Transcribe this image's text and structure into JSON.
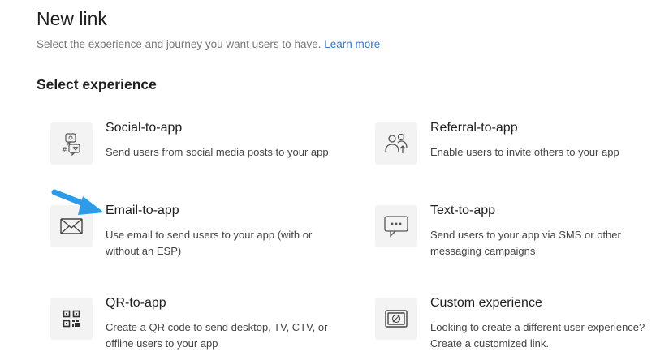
{
  "header": {
    "title": "New link",
    "subtitle": "Select the experience and journey you want users to have.",
    "learn_more": "Learn more"
  },
  "section": {
    "title": "Select experience"
  },
  "cards": {
    "social": {
      "title": "Social-to-app",
      "description": "Send users from social media posts to your app",
      "icon": "social-chat-icon"
    },
    "referral": {
      "title": "Referral-to-app",
      "description": "Enable users to invite others to your app",
      "icon": "referral-users-icon"
    },
    "email": {
      "title": "Email-to-app",
      "description": "Use email to send users to your app (with or without an ESP)",
      "icon": "envelope-icon"
    },
    "text": {
      "title": "Text-to-app",
      "description": "Send users to your app via SMS or other messaging campaigns",
      "icon": "sms-bubble-icon"
    },
    "qr": {
      "title": "QR-to-app",
      "description": "Create a QR code to send desktop, TV, CTV, or offline users to your app",
      "icon": "qr-code-icon"
    },
    "custom": {
      "title": "Custom experience",
      "description": "Looking to create a different user experience? Create a customized link.",
      "icon": "custom-link-icon"
    }
  },
  "colors": {
    "link": "#2f79c8",
    "arrow": "#2b9bea",
    "icon_bg": "#f3f3f3"
  }
}
